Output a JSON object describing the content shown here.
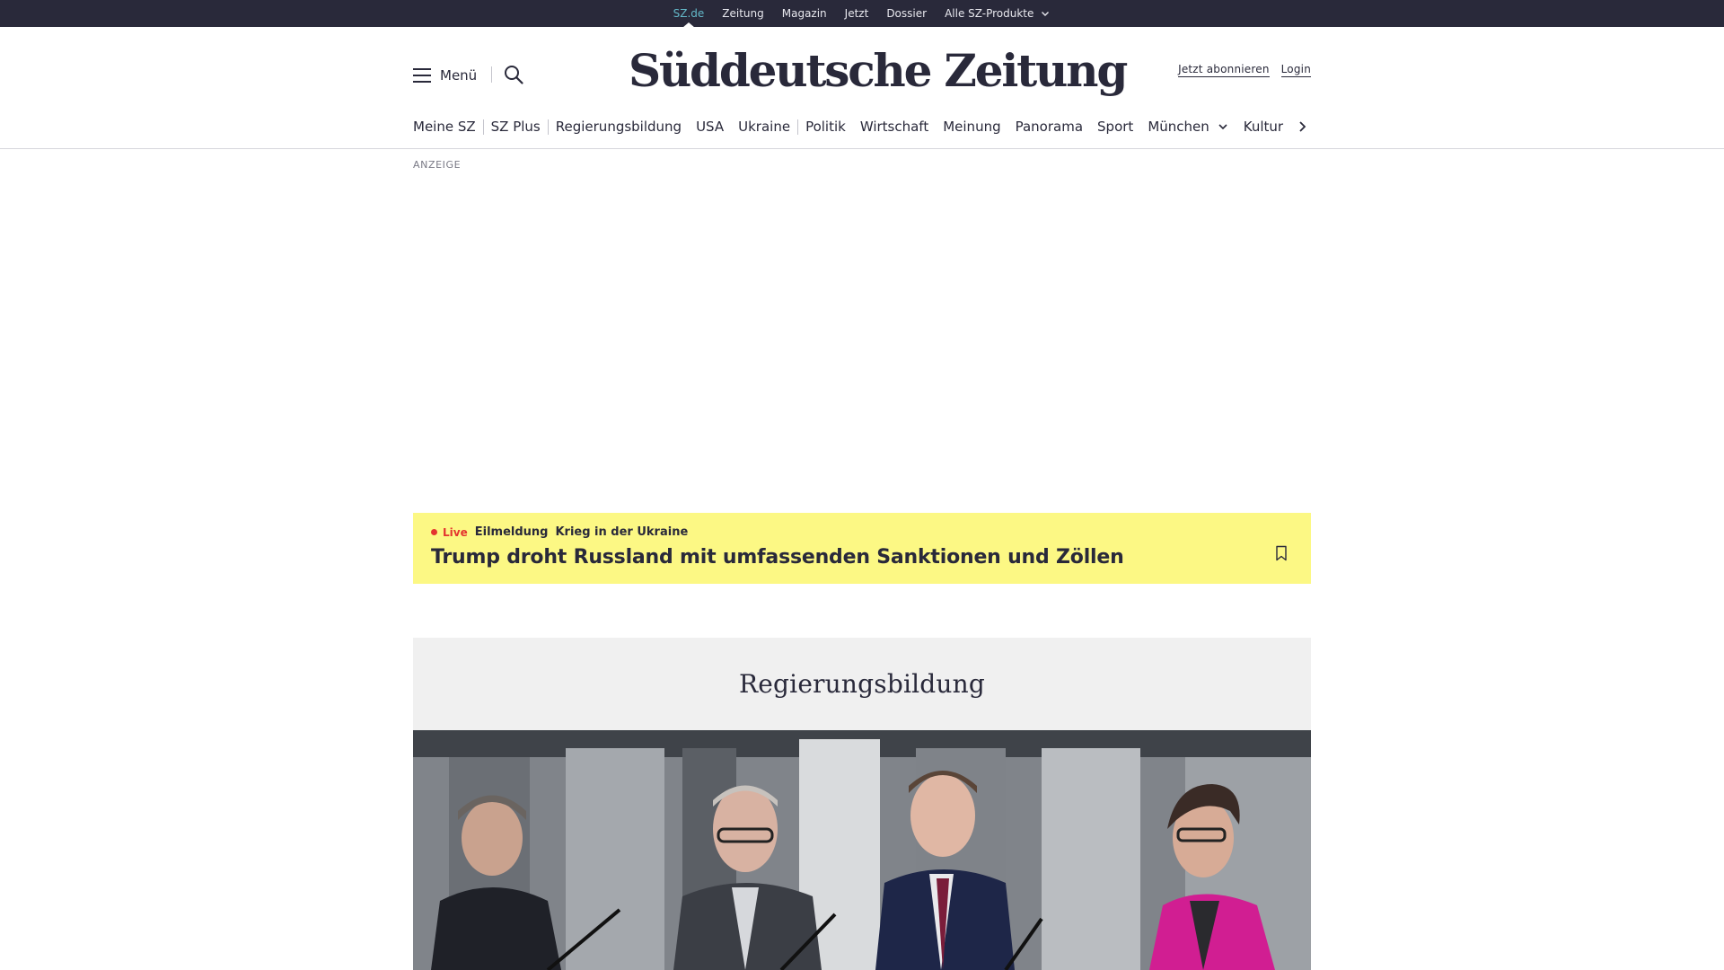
{
  "topbar": {
    "items": [
      "SZ.de",
      "Zeitung",
      "Magazin",
      "Jetzt",
      "Dossier",
      "Alle SZ-Produkte"
    ]
  },
  "header": {
    "menu_label": "Menü",
    "logo_text": "Süddeutsche Zeitung",
    "subscribe_label": "Jetzt abonnieren",
    "login_label": "Login"
  },
  "nav": {
    "items": [
      "Meine SZ",
      "SZ Plus",
      "Regierungsbildung",
      "USA",
      "Ukraine",
      "Politik",
      "Wirtschaft",
      "Meinung",
      "Panorama",
      "Sport",
      "München",
      "Kultur"
    ]
  },
  "ad": {
    "label": "ANZEIGE"
  },
  "breaking": {
    "live_label": "Live",
    "kicker": "Eilmeldung",
    "topic": "Krieg in der Ukraine",
    "headline": "Trump droht Russland mit umfassenden Sanktionen und Zöllen"
  },
  "topic_block": {
    "title": "Regierungsbildung"
  },
  "colors": {
    "topbar_bg": "#29293a",
    "active_link": "#64b9c9",
    "breaking_bg": "#fcf884",
    "live_red": "#e3342f",
    "topic_bg": "#f0f0f0"
  }
}
